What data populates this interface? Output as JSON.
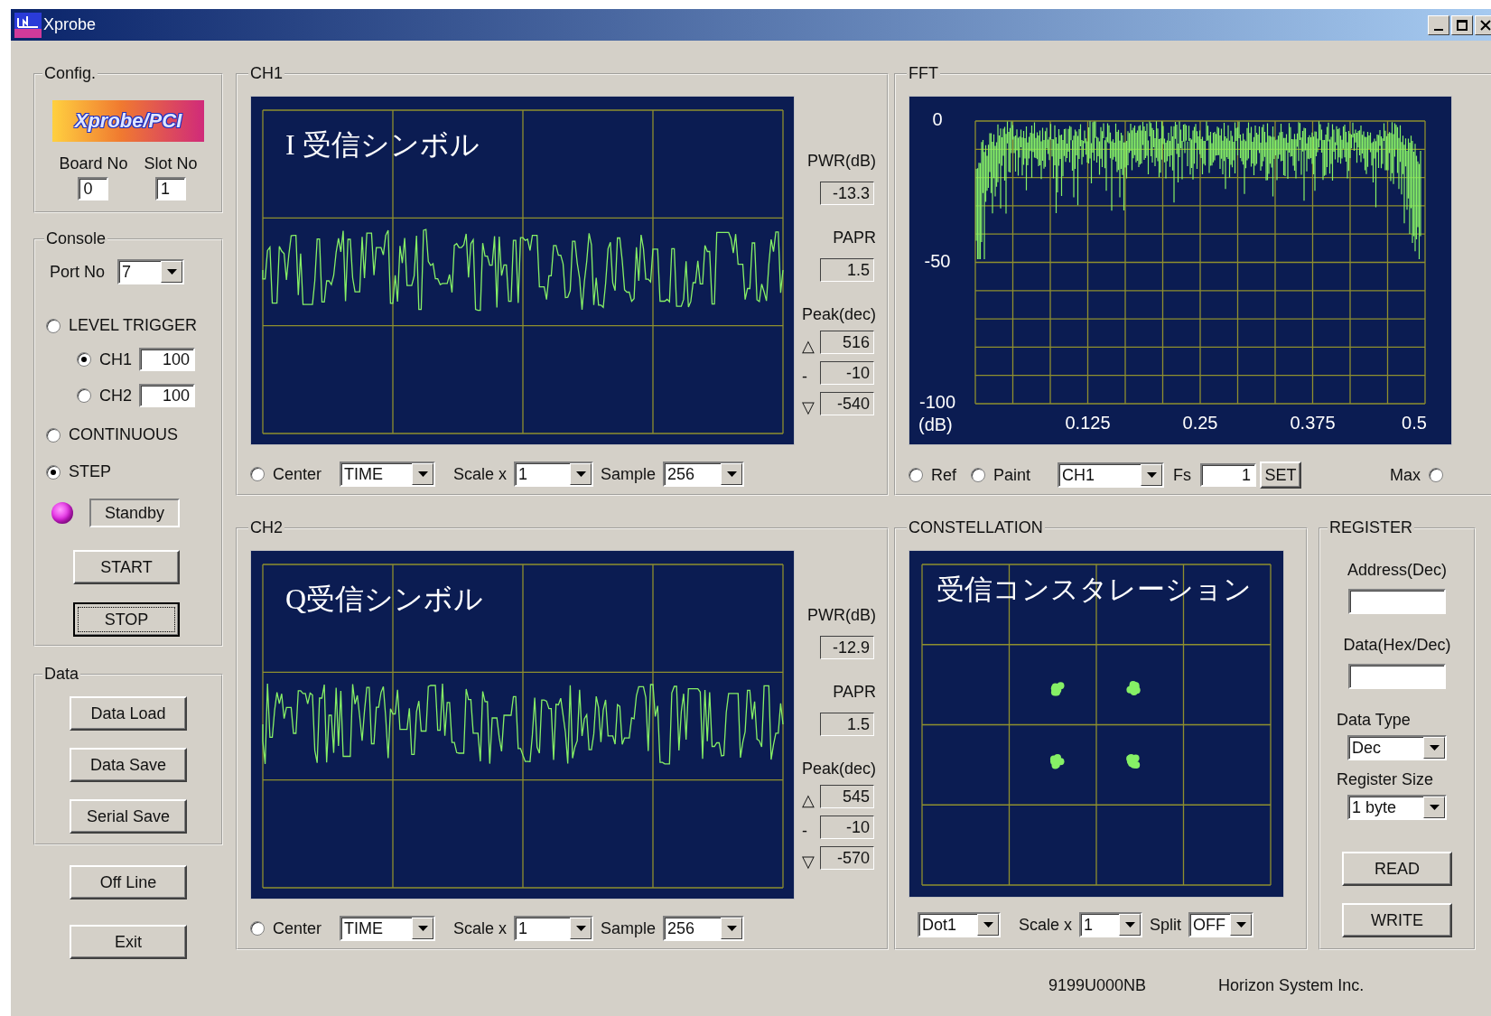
{
  "window": {
    "title": "Xprobe"
  },
  "config": {
    "title": "Config.",
    "logo": "Xprobe/PCI",
    "fields": [
      {
        "label": "Board No",
        "value": "0"
      },
      {
        "label": "Slot No",
        "value": "1"
      }
    ]
  },
  "console": {
    "title": "Console",
    "port_label": "Port No",
    "port": "7",
    "modes": [
      {
        "label": "LEVEL TRIGGER",
        "selected": false,
        "channels": [
          {
            "label": "CH1",
            "selected": true,
            "value": "100"
          },
          {
            "label": "CH2",
            "selected": false,
            "value": "100"
          }
        ]
      },
      {
        "label": "CONTINUOUS",
        "selected": false
      },
      {
        "label": "STEP",
        "selected": true
      }
    ],
    "status": {
      "on": true,
      "text": "Standby"
    },
    "buttons": [
      {
        "label": "START",
        "focused": false
      },
      {
        "label": "STOP",
        "focused": true
      }
    ]
  },
  "data": {
    "title": "Data",
    "buttons": [
      "Data Load",
      "Data Save",
      "Serial  Save"
    ]
  },
  "bottom_buttons": [
    "Off Line",
    "Exit"
  ],
  "channels": [
    {
      "title": "CH1",
      "overlay": "I 受信シンボル",
      "pwr_label": "PWR(dB)",
      "pwr": "-13.3",
      "papr_label": "PAPR",
      "papr": "1.5",
      "peak_label": "Peak(dec)",
      "peaks": [
        {
          "symbol": "△",
          "value": "516"
        },
        {
          "symbol": "-",
          "value": "-10"
        },
        {
          "symbol": "▽",
          "value": "-540"
        }
      ],
      "center": {
        "label": "Center",
        "selected": false
      },
      "mode": "TIME",
      "scale_label": "Scale x",
      "scale": "1",
      "sample_label": "Sample",
      "sample": "256"
    },
    {
      "title": "CH2",
      "overlay": "Q受信シンボル",
      "pwr_label": "PWR(dB)",
      "pwr": "-12.9",
      "papr_label": "PAPR",
      "papr": "1.5",
      "peak_label": "Peak(dec)",
      "peaks": [
        {
          "symbol": "△",
          "value": "545"
        },
        {
          "symbol": "-",
          "value": "-10"
        },
        {
          "symbol": "▽",
          "value": "-570"
        }
      ],
      "center": {
        "label": "Center",
        "selected": false
      },
      "mode": "TIME",
      "scale_label": "Scale x",
      "scale": "1",
      "sample_label": "Sample",
      "sample": "256"
    }
  ],
  "fft": {
    "title": "FFT",
    "y_labels": [
      "0",
      "-50",
      "-100"
    ],
    "unit": "(dB)",
    "x_labels": [
      "0.125",
      "0.25",
      "0.375",
      "0.5"
    ],
    "ref": {
      "label": "Ref",
      "selected": false
    },
    "paint": {
      "label": "Paint",
      "selected": false
    },
    "channel": "CH1",
    "fs_label": "Fs",
    "fs": "1",
    "set": "SET",
    "max": {
      "label": "Max",
      "selected": false
    }
  },
  "constellation": {
    "title": "CONSTELLATION",
    "overlay": "受信コンスタレーション",
    "mode": "Dot1",
    "scale_label": "Scale x",
    "scale": "1",
    "split_label": "Split",
    "split": "OFF"
  },
  "register": {
    "title": "REGISTER",
    "fields": [
      {
        "label": "Address(Dec)"
      },
      {
        "label": "Data(Hex/Dec)"
      }
    ],
    "selects": [
      {
        "label": "Data Type",
        "value": "Dec"
      },
      {
        "label": "Register Size",
        "value": "1 byte"
      }
    ],
    "buttons": [
      "READ",
      "WRITE"
    ]
  },
  "footer": [
    "9199U000NB",
    "Horizon System Inc."
  ]
}
